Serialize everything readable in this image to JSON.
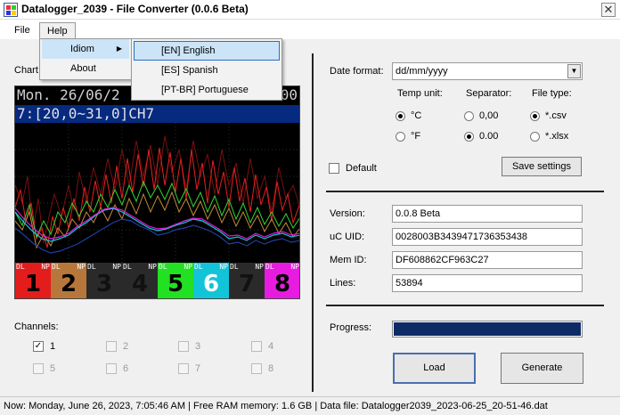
{
  "window": {
    "title": "Datalogger_2039 - File Converter (0.0.6 Beta)",
    "close_glyph": "✕"
  },
  "menu": {
    "file": "File",
    "help": "Help",
    "help_items": [
      {
        "label": "Idiom",
        "has_submenu": true,
        "arrow": "▶"
      },
      {
        "label": "About"
      }
    ],
    "idiom_items": [
      {
        "label": "[EN] English",
        "selected": true
      },
      {
        "label": "[ES] Spanish"
      },
      {
        "label": "[PT-BR] Portuguese"
      }
    ]
  },
  "chart": {
    "label": "Chart",
    "date_line": "Mon. 26/06/2",
    "date_tail": "00",
    "range_line": "7:[20,0~31,0]CH7",
    "tiles": [
      {
        "tag": "DL",
        "flag": "NP",
        "num": "1",
        "bg": "#e31c1c",
        "fg": "#000000"
      },
      {
        "tag": "DL",
        "flag": "NP",
        "num": "2",
        "bg": "#b8773a",
        "fg": "#000000"
      },
      {
        "tag": "DL",
        "flag": "NP",
        "num": "3",
        "bg": "#2a2a2a",
        "fg": "#111111"
      },
      {
        "tag": "DL",
        "flag": "NP",
        "num": "4",
        "bg": "#2a2a2a",
        "fg": "#111111"
      },
      {
        "tag": "DL",
        "flag": "NP",
        "num": "5",
        "bg": "#22e022",
        "fg": "#000000"
      },
      {
        "tag": "DL",
        "flag": "NP",
        "num": "6",
        "bg": "#12c4d8",
        "fg": "#ffffff"
      },
      {
        "tag": "DL",
        "flag": "NP",
        "num": "7",
        "bg": "#2a2a2a",
        "fg": "#111111"
      },
      {
        "tag": "DL",
        "flag": "NP",
        "num": "8",
        "bg": "#e81ce0",
        "fg": "#000000"
      }
    ]
  },
  "channels": {
    "label": "Channels:",
    "items": [
      {
        "label": "1",
        "checked": true,
        "enabled": true,
        "check_glyph": "✓"
      },
      {
        "label": "2",
        "checked": false,
        "enabled": false
      },
      {
        "label": "3",
        "checked": false,
        "enabled": false
      },
      {
        "label": "4",
        "checked": false,
        "enabled": false
      },
      {
        "label": "5",
        "checked": false,
        "enabled": false
      },
      {
        "label": "6",
        "checked": false,
        "enabled": false
      },
      {
        "label": "7",
        "checked": false,
        "enabled": false
      },
      {
        "label": "8",
        "checked": false,
        "enabled": false
      }
    ]
  },
  "settings": {
    "date_format_label": "Date format:",
    "date_format_value": "dd/mm/yyyy",
    "temp_unit_label": "Temp unit:",
    "separator_label": "Separator:",
    "file_type_label": "File type:",
    "temp_c": "°C",
    "temp_f": "°F",
    "sep_comma": "0,00",
    "sep_dot": "0.00",
    "type_csv": "*.csv",
    "type_xlsx": "*.xlsx",
    "default_label": "Default",
    "save_button": "Save settings"
  },
  "info": {
    "version_label": "Version:",
    "version_value": "0.0.8 Beta",
    "uid_label": "uC UID:",
    "uid_value": "0028003B3439471736353438",
    "memid_label": "Mem ID:",
    "memid_value": "DF608862CF963C27",
    "lines_label": "Lines:",
    "lines_value": "53894"
  },
  "progress": {
    "label": "Progress:",
    "value": 1.0,
    "color": "#0d2a66"
  },
  "buttons": {
    "load": "Load",
    "generate": "Generate"
  },
  "status": {
    "text": "Now: Monday, June 26, 2023, 7:05:46 AM | Free RAM memory: 1.6 GB | Data file: Datalogger2039_2023-06-25_20-51-46.dat"
  }
}
